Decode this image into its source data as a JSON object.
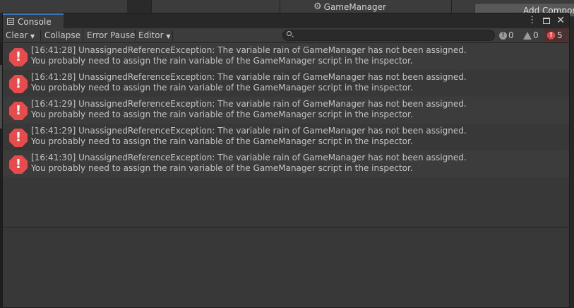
{
  "background": {
    "game_manager_label": "GameManager",
    "game_manager_icon": "gear-icon",
    "add_component_label": "Add Component"
  },
  "window": {
    "tab_label": "Console",
    "tab_icon": "console-icon"
  },
  "toolbar": {
    "clear_label": "Clear",
    "collapse_label": "Collapse",
    "error_pause_label": "Error Pause",
    "editor_label": "Editor",
    "search": {
      "value": "",
      "placeholder": ""
    },
    "info_count": "0",
    "warning_count": "0",
    "error_count": "5"
  },
  "colors": {
    "accent": "#3a79bb",
    "error": "#e84b4b",
    "row_alt": "#3c3c3c",
    "row_base": "#383838"
  },
  "entries": [
    {
      "line1": "[16:41:28] UnassignedReferenceException: The variable rain of GameManager has not been assigned.",
      "line2": "You probably need to assign the rain variable of the GameManager script in the inspector."
    },
    {
      "line1": "[16:41:28] UnassignedReferenceException: The variable rain of GameManager has not been assigned.",
      "line2": "You probably need to assign the rain variable of the GameManager script in the inspector."
    },
    {
      "line1": "[16:41:29] UnassignedReferenceException: The variable rain of GameManager has not been assigned.",
      "line2": "You probably need to assign the rain variable of the GameManager script in the inspector."
    },
    {
      "line1": "[16:41:29] UnassignedReferenceException: The variable rain of GameManager has not been assigned.",
      "line2": "You probably need to assign the rain variable of the GameManager script in the inspector."
    },
    {
      "line1": "[16:41:30] UnassignedReferenceException: The variable rain of GameManager has not been assigned.",
      "line2": "You probably need to assign the rain variable of the GameManager script in the inspector."
    }
  ]
}
